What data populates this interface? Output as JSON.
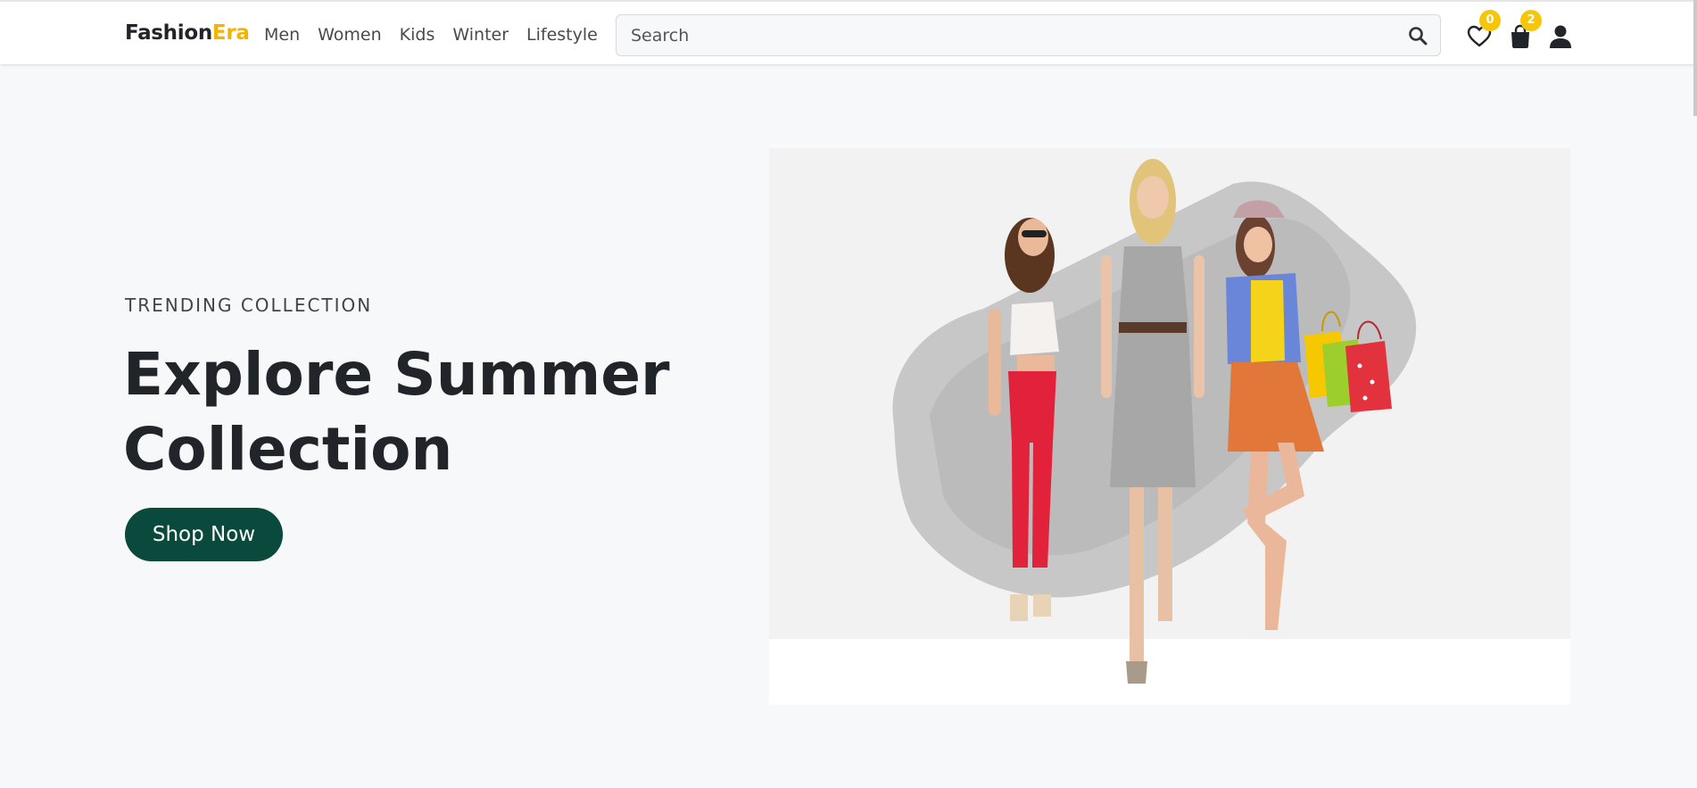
{
  "brand": {
    "name_main": "Fashion",
    "name_accent": "Era",
    "accent_color": "#f5b301"
  },
  "nav": {
    "items": [
      {
        "label": "Men"
      },
      {
        "label": "Women"
      },
      {
        "label": "Kids"
      },
      {
        "label": "Winter"
      },
      {
        "label": "Lifestyle"
      }
    ]
  },
  "search": {
    "placeholder": "Search",
    "value": ""
  },
  "header_icons": {
    "wishlist": {
      "icon": "heart-icon",
      "count": "0"
    },
    "cart": {
      "icon": "shopping-bag-icon",
      "count": "2"
    },
    "account": {
      "icon": "user-icon"
    }
  },
  "hero": {
    "eyebrow": "TRENDING COLLECTION",
    "headline_line1": "Explore Summer",
    "headline_line2": "Collection",
    "cta_label": "Shop Now",
    "cta_color": "#0a4a3c",
    "image": "three-models-shopping-bags"
  }
}
